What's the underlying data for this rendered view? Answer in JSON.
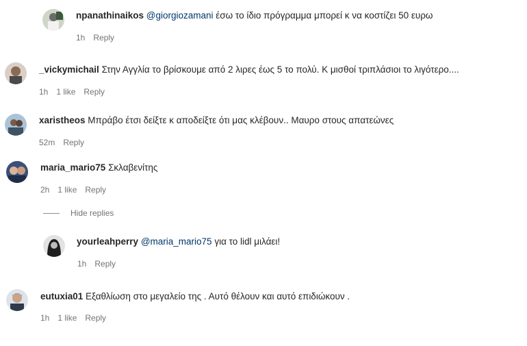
{
  "comments": [
    {
      "username": "npanathinaikos",
      "mention": "@giorgiozamani",
      "text": " έσω το ίδιο πρόγραμμα μπορεί κ να κοστίζει 50 ευρω",
      "time": "1h",
      "likes": "",
      "reply": "Reply"
    },
    {
      "username": "_vickymichail",
      "mention": "",
      "text": " Στην Αγγλία το βρίσκουμε από 2 λιρες έως 5 το πολύ. Κ μισθοί τριπλάσιοι το λιγότερο....",
      "time": "1h",
      "likes": "1 like",
      "reply": "Reply"
    },
    {
      "username": "xaristheos",
      "mention": "",
      "text": " Μπράβο έτσι δείξτε κ αποδείξτε ότι μας κλέβουν.. Μαυρο στους απατεώνες",
      "time": "52m",
      "likes": "",
      "reply": "Reply"
    },
    {
      "username": "maria_mario75",
      "mention": "",
      "text": " Σκλαβενίτης",
      "time": "2h",
      "likes": "1 like",
      "reply": "Reply"
    },
    {
      "username": "yourleahperry",
      "mention": "@maria_mario75",
      "text": " για το lidl μιλάει!",
      "time": "1h",
      "likes": "",
      "reply": "Reply"
    },
    {
      "username": "eutuxia01",
      "mention": "",
      "text": " Εξαθλίωση στο μεγαλείο της . Αυτό θέλουν και αυτό επιδιώκουν .",
      "time": "1h",
      "likes": "1 like",
      "reply": "Reply"
    }
  ],
  "hide_replies": "Hide replies"
}
